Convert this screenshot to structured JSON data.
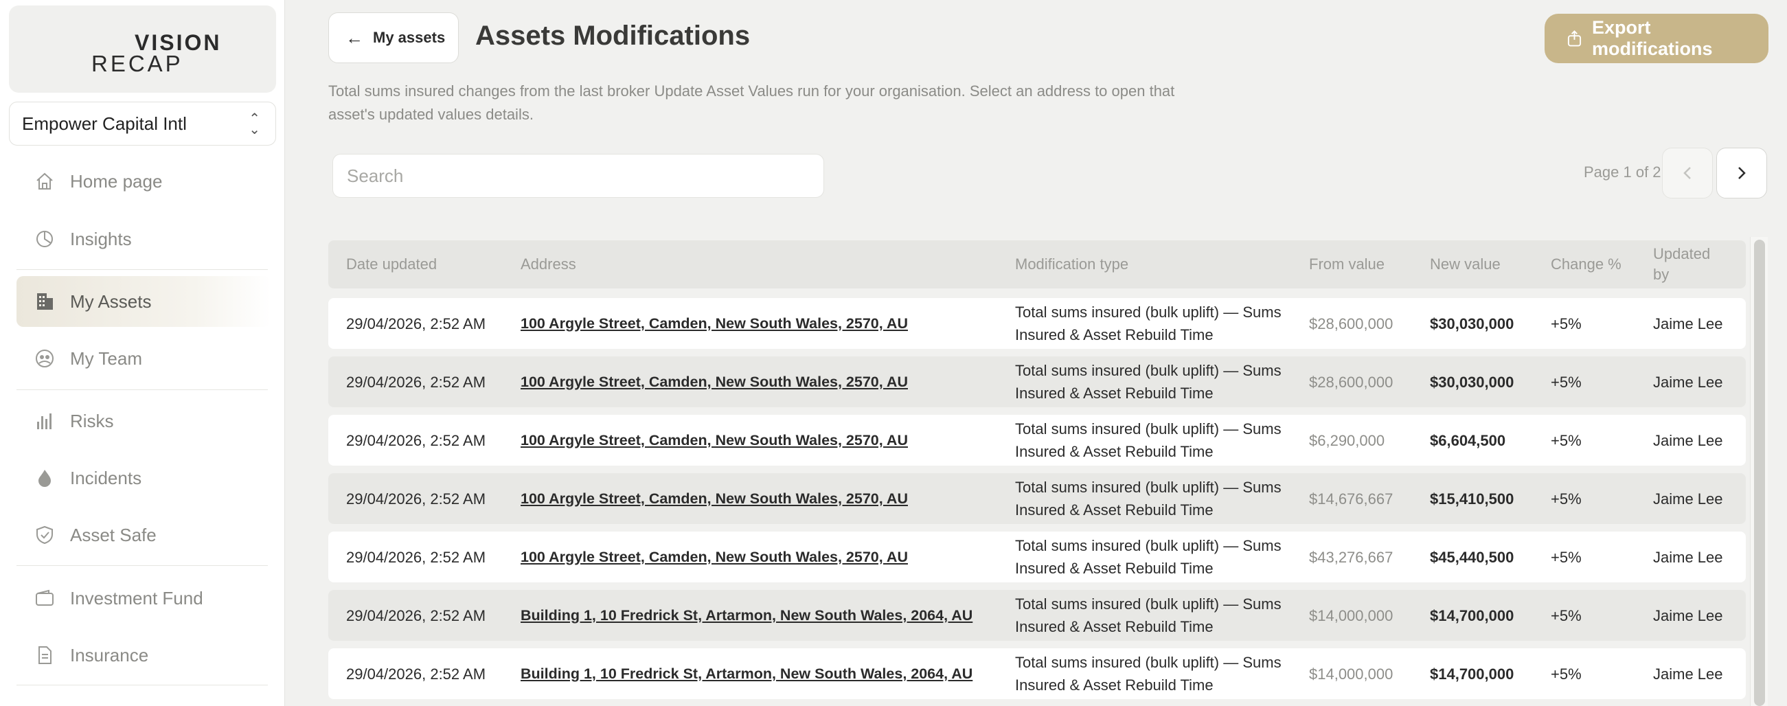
{
  "brand": {
    "logo_top": "VISION",
    "logo_bottom": "RECAP"
  },
  "org_selector": {
    "value": "Empower Capital Intl"
  },
  "sidebar": {
    "items": [
      {
        "label": "Home page",
        "icon": "home-icon"
      },
      {
        "label": "Insights",
        "icon": "pie-chart-icon"
      },
      {
        "label": "My Assets",
        "icon": "building-icon",
        "active": true
      },
      {
        "label": "My Team",
        "icon": "team-icon"
      },
      {
        "label": "Risks",
        "icon": "bar-chart-icon"
      },
      {
        "label": "Incidents",
        "icon": "flame-icon"
      },
      {
        "label": "Asset Safe",
        "icon": "shield-icon"
      },
      {
        "label": "Investment Fund",
        "icon": "wallet-icon"
      },
      {
        "label": "Insurance",
        "icon": "document-icon"
      }
    ]
  },
  "header": {
    "back_label": "My assets",
    "title": "Assets Modifications",
    "export_label": "Export modifications",
    "description": "Total sums insured changes from the last broker Update Asset Values run for your organisation. Select an address to open that asset's updated values details."
  },
  "search": {
    "placeholder": "Search",
    "value": ""
  },
  "pagination": {
    "label": "Page 1 of 2"
  },
  "table": {
    "columns": {
      "date": "Date updated",
      "address": "Address",
      "mod": "Modification type",
      "from": "From value",
      "new": "New value",
      "change": "Change %",
      "by": "Updated by"
    },
    "rows": [
      {
        "date": "29/04/2026, 2:52 AM",
        "address": "100 Argyle Street, Camden, New South Wales, 2570, AU",
        "mod": "Total sums insured (bulk uplift) — Sums Insured & Asset Rebuild Time",
        "from": "$28,600,000",
        "new": "$30,030,000",
        "change": "+5%",
        "by": "Jaime Lee"
      },
      {
        "date": "29/04/2026, 2:52 AM",
        "address": "100 Argyle Street, Camden, New South Wales, 2570, AU",
        "mod": "Total sums insured (bulk uplift) — Sums Insured & Asset Rebuild Time",
        "from": "$28,600,000",
        "new": "$30,030,000",
        "change": "+5%",
        "by": "Jaime Lee"
      },
      {
        "date": "29/04/2026, 2:52 AM",
        "address": "100 Argyle Street, Camden, New South Wales, 2570, AU",
        "mod": "Total sums insured (bulk uplift) — Sums Insured & Asset Rebuild Time",
        "from": "$6,290,000",
        "new": "$6,604,500",
        "change": "+5%",
        "by": "Jaime Lee"
      },
      {
        "date": "29/04/2026, 2:52 AM",
        "address": "100 Argyle Street, Camden, New South Wales, 2570, AU",
        "mod": "Total sums insured (bulk uplift) — Sums Insured & Asset Rebuild Time",
        "from": "$14,676,667",
        "new": "$15,410,500",
        "change": "+5%",
        "by": "Jaime Lee"
      },
      {
        "date": "29/04/2026, 2:52 AM",
        "address": "100 Argyle Street, Camden, New South Wales, 2570, AU",
        "mod": "Total sums insured (bulk uplift) — Sums Insured & Asset Rebuild Time",
        "from": "$43,276,667",
        "new": "$45,440,500",
        "change": "+5%",
        "by": "Jaime Lee"
      },
      {
        "date": "29/04/2026, 2:52 AM",
        "address": "Building 1, 10 Fredrick St, Artarmon, New South Wales, 2064, AU",
        "mod": "Total sums insured (bulk uplift) — Sums Insured & Asset Rebuild Time",
        "from": "$14,000,000",
        "new": "$14,700,000",
        "change": "+5%",
        "by": "Jaime Lee"
      },
      {
        "date": "29/04/2026, 2:52 AM",
        "address": "Building 1, 10 Fredrick St, Artarmon, New South Wales, 2064, AU",
        "mod": "Total sums insured (bulk uplift) — Sums Insured & Asset Rebuild Time",
        "from": "$14,000,000",
        "new": "$14,700,000",
        "change": "+5%",
        "by": "Jaime Lee"
      }
    ]
  },
  "colors": {
    "accent": "#c8b68a",
    "active_nav": "#ebe7dc",
    "row_alt": "#e8e8e5"
  }
}
